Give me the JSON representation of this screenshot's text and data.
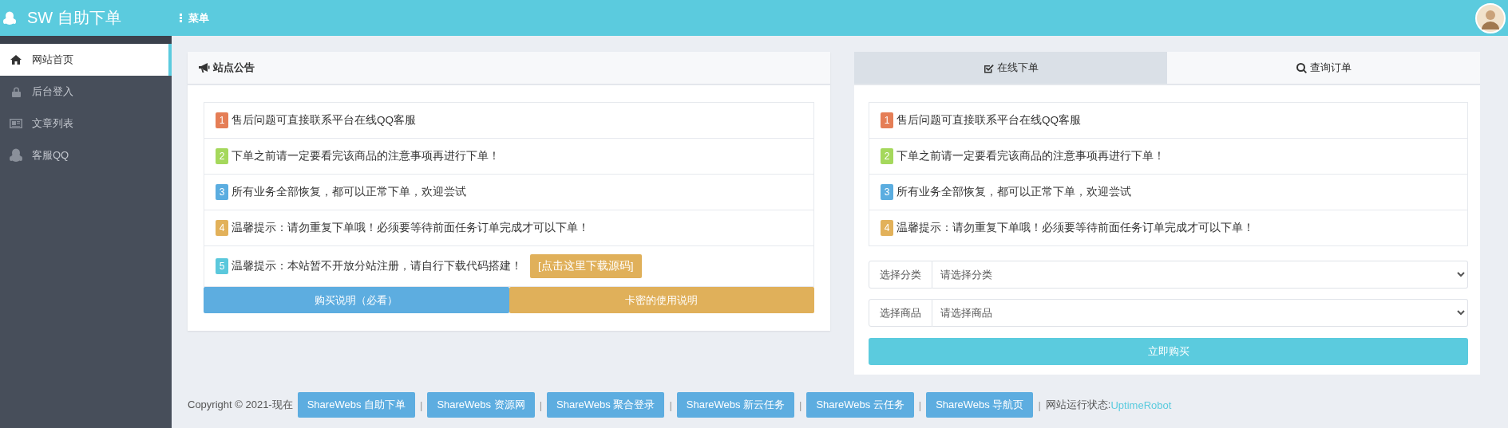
{
  "header": {
    "brand": "SW 自助下单",
    "menu_label": "菜单"
  },
  "sidebar": {
    "items": [
      {
        "label": "网站首页",
        "kind": "home",
        "selected": true
      },
      {
        "label": "后台登入",
        "kind": "lock",
        "selected": false
      },
      {
        "label": "文章列表",
        "kind": "newspaper",
        "selected": false
      },
      {
        "label": "客服QQ",
        "kind": "penguin",
        "selected": false
      }
    ]
  },
  "notice_panel": {
    "title": "站点公告",
    "notices": [
      {
        "number": "1",
        "text": "售后问题可直接联系平台在线QQ客服",
        "color": "#e57e56"
      },
      {
        "number": "2",
        "text": "下单之前请一定要看完该商品的注意事项再进行下单！",
        "color": "#a5d85c"
      },
      {
        "number": "3",
        "text": "所有业务全部恢复，都可以正常下单，欢迎尝试",
        "color": "#5bade0"
      },
      {
        "number": "4",
        "text": "温馨提示：请勿重复下单哦！必须要等待前面任务订单完成才可以下单！",
        "color": "#e2b15a"
      },
      {
        "number": "5",
        "text": "温馨提示：本站暂不开放分站注册，请自行下载代码搭建！",
        "color": "#5bc8dc",
        "link": "[点击这里下载源码]"
      }
    ],
    "buttons": [
      {
        "label": "购买说明（必看）",
        "color": "#5dade0"
      },
      {
        "label": "卡密的使用说明",
        "color": "#e0b05a"
      }
    ]
  },
  "order_panel": {
    "tabs": [
      {
        "label": "在线下单",
        "kind": "check",
        "selected": true
      },
      {
        "label": "查询订单",
        "kind": "search",
        "selected": false
      }
    ],
    "notices": [
      {
        "number": "1",
        "text": "售后问题可直接联系平台在线QQ客服",
        "color": "#e57e56"
      },
      {
        "number": "2",
        "text": "下单之前请一定要看完该商品的注意事项再进行下单！",
        "color": "#a5d85c"
      },
      {
        "number": "3",
        "text": "所有业务全部恢复，都可以正常下单，欢迎尝试",
        "color": "#5bade0"
      },
      {
        "number": "4",
        "text": "温馨提示：请勿重复下单哦！必须要等待前面任务订单完成才可以下单！",
        "color": "#e2b15a"
      }
    ],
    "selects": [
      {
        "label": "选择分类",
        "value": "请选择分类"
      },
      {
        "label": "选择商品",
        "value": "请选择商品"
      }
    ],
    "submit": "立即购买"
  },
  "footer": {
    "copyright": "Copyright © 2021-现在",
    "links": [
      "ShareWebs 自助下单",
      "ShareWebs 资源网",
      "ShareWebs 聚合登录",
      "ShareWebs 新云任务",
      "ShareWebs 云任务",
      "ShareWebs 导航页"
    ],
    "separator": "|",
    "status_label": "网站运行状态:",
    "status_link": "UptimeRobot"
  }
}
